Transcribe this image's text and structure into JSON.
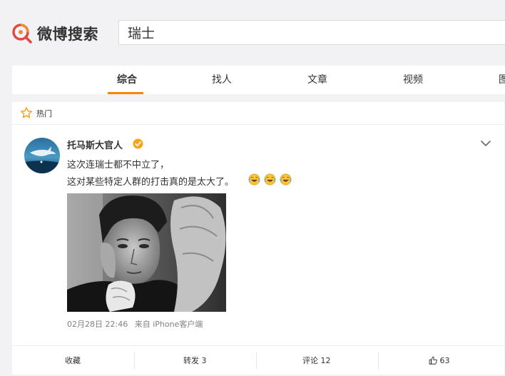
{
  "header": {
    "logo_text": "微博搜索",
    "search_value": "瑞士"
  },
  "tabs": [
    {
      "label": "综合",
      "active": true
    },
    {
      "label": "找人",
      "active": false
    },
    {
      "label": "文章",
      "active": false
    },
    {
      "label": "视频",
      "active": false
    },
    {
      "label": "图",
      "active": false
    }
  ],
  "feed": {
    "section_label": "热门",
    "post": {
      "username": "托马斯大官人",
      "verified_badge": "verified-icon",
      "line1": "这次连瑞士都不中立了，",
      "line2": "这对某些特定人群的打击真的是太大了。",
      "emoji_icon": "laugh-cry-emoji",
      "timestamp": "02月28日 22:46",
      "source": "来自 iPhone客户端"
    },
    "actions": {
      "favorite": "收藏",
      "repost": "转发 3",
      "comment": "评论 12",
      "like_count": "63"
    }
  },
  "colors": {
    "accent": "#ff8200",
    "logo_orange": "#f08a35",
    "logo_red": "#e2483d",
    "verify": "#f7a51b"
  }
}
